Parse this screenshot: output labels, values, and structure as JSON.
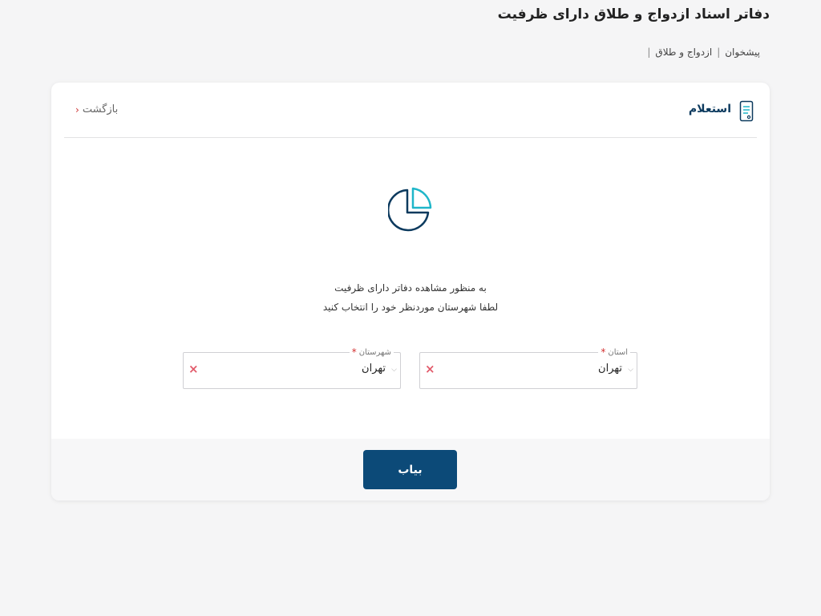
{
  "page": {
    "title": "دفاتر اسناد ازدواج و طلاق دارای ظرفیت"
  },
  "breadcrumb": {
    "home": "پیشخوان",
    "section": "ازدواج و طلاق"
  },
  "card": {
    "header_title": "استعلام",
    "back_label": "بازگشت",
    "message_line1": "به منظور مشاهده دفاتر دارای ظرفیت",
    "message_line2": "لطفا شهرستان موردنظر خود را انتخاب کنید"
  },
  "fields": {
    "province": {
      "label": "استان",
      "required_mark": "*",
      "value": "تهران"
    },
    "city": {
      "label": "شهرستان",
      "required_mark": "*",
      "value": "تهران"
    }
  },
  "actions": {
    "find_label": "بیاب"
  },
  "colors": {
    "primary": "#0c4a78",
    "accent": "#1fb6c9",
    "required": "#d32f2f",
    "clear": "#e25b6b"
  },
  "icons": {
    "header": "document-icon",
    "hero": "pie-chart-icon",
    "back": "chevron-left-icon",
    "clear": "close-icon",
    "dropdown": "chevron-down-icon"
  }
}
